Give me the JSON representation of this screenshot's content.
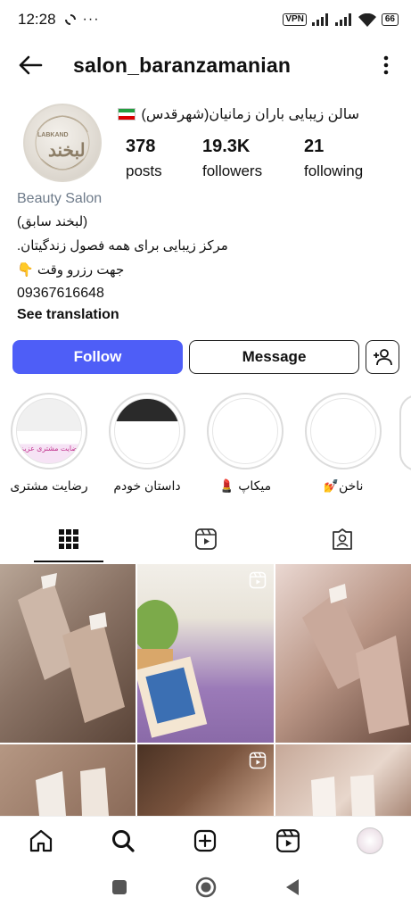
{
  "status_bar": {
    "time": "12:28",
    "vpn": "VPN",
    "battery": "66"
  },
  "header": {
    "username": "salon_baranzamanian"
  },
  "profile": {
    "bio_title": "سالن زیبایی باران زمانیان(شهرقدس)",
    "category": "Beauty Salon",
    "bio_lines": [
      "(لبخند سابق)",
      ".مرکز زیبایی برای همه فصول زندگیتان",
      "👇 جهت رزرو وقت",
      "09367616648"
    ],
    "see_translation": "See translation",
    "stats": {
      "posts_count": "378",
      "posts_label": "posts",
      "followers_count": "19.3K",
      "followers_label": "followers",
      "following_count": "21",
      "following_label": "following"
    },
    "avatar_logo_text": "لبخند",
    "avatar_logo_latin": "LABKAND"
  },
  "buttons": {
    "follow": "Follow",
    "message": "Message"
  },
  "highlights": [
    {
      "label": "رضایت مشتری",
      "thumb_caption": "رضایت مشتری عزیزم"
    },
    {
      "label": "داستان خودم"
    },
    {
      "label": "میکاپ 💄"
    },
    {
      "label": "ناخن💅"
    }
  ],
  "colors": {
    "follow_blue": "#4e5ef7",
    "category_gray": "#6e7b8a"
  },
  "icons": {
    "back": "arrow-left-icon",
    "more": "more-vertical-icon",
    "add_user": "add-user-icon",
    "grid_tab": "grid-icon",
    "reels_tab": "reels-icon",
    "tagged_tab": "tagged-icon",
    "home": "home-icon",
    "search": "search-icon",
    "create": "create-icon",
    "reels": "reels-icon",
    "recents": "square-icon",
    "android_home": "circle-icon",
    "android_back": "triangle-back-icon"
  }
}
